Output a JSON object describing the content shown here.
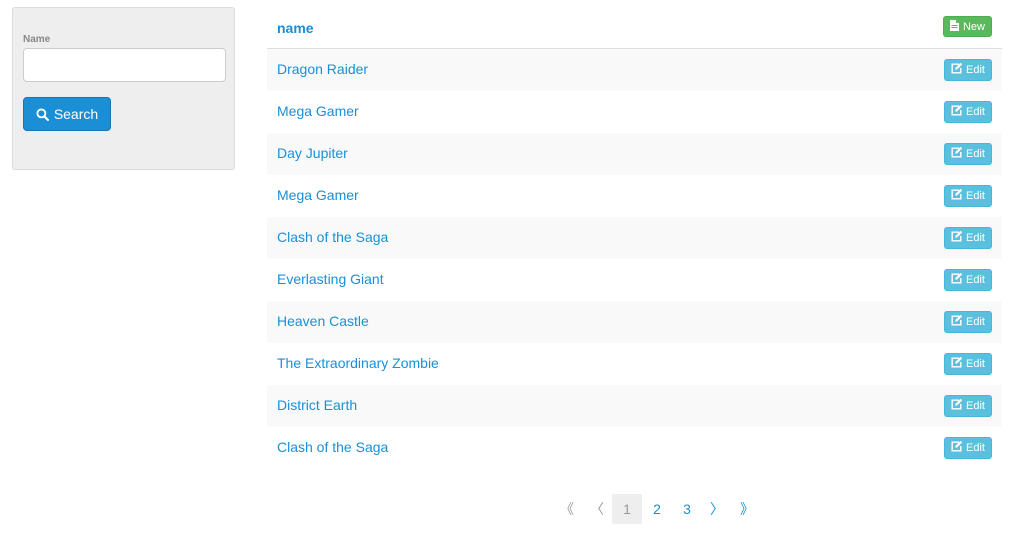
{
  "filter": {
    "name_label": "Name",
    "name_value": "",
    "name_placeholder": "",
    "search_label": "Search"
  },
  "table": {
    "header_name": "name",
    "new_label": "New",
    "edit_label": "Edit",
    "rows": [
      "Dragon Raider",
      "Mega Gamer",
      "Day Jupiter",
      "Mega Gamer",
      "Clash of the Saga",
      "Everlasting Giant",
      "Heaven Castle",
      "The Extraordinary Zombie",
      "District Earth",
      "Clash of the Saga"
    ]
  },
  "pagination": {
    "first": "《",
    "prev": "〈",
    "pages": [
      "1",
      "2",
      "3"
    ],
    "current_page": "1",
    "next": "〉",
    "last": "》"
  },
  "colors": {
    "primary": "#1a8fd6",
    "success": "#5cb85c",
    "info": "#5bc0de"
  }
}
